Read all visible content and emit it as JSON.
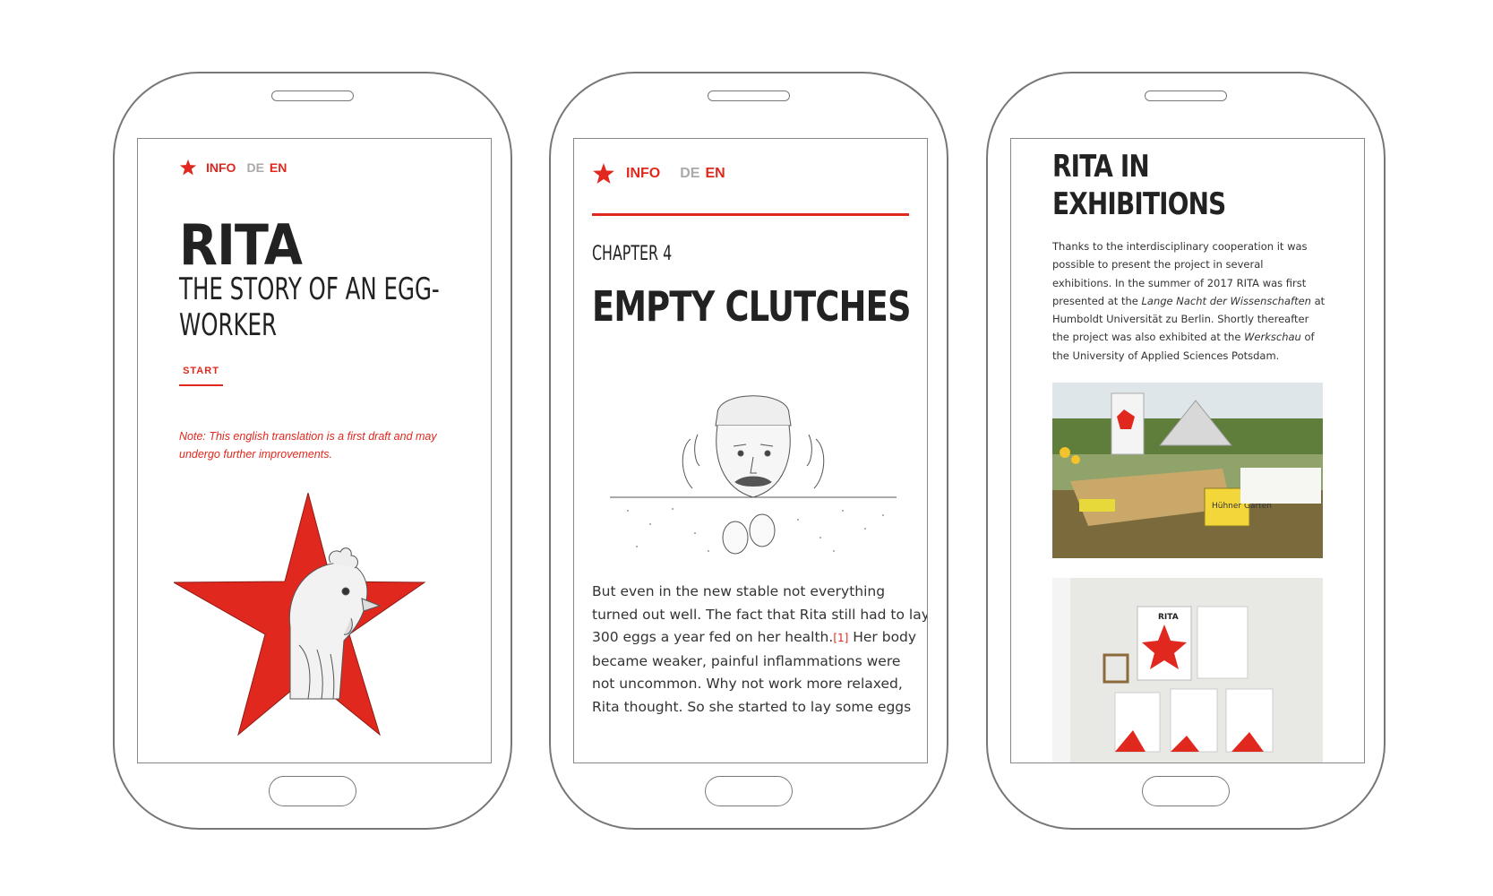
{
  "colors": {
    "accent": "#e0281e",
    "text": "#222222",
    "muted": "#aaaaaa",
    "frame": "#777777"
  },
  "nav": {
    "info": "INFO",
    "de": "DE",
    "en": "EN",
    "star_icon": "star-icon"
  },
  "screen1": {
    "title": "RITA",
    "subtitle_line1": "THE STORY OF AN EGG-",
    "subtitle_line2": "WORKER",
    "start": "START",
    "note_line1": "Note: This english translation is a first draft and may",
    "note_line2": "undergo further improvements."
  },
  "screen2": {
    "chapter": "CHAPTER 4",
    "title": "EMPTY CLUTCHES",
    "lines": [
      "But even in the new stable not everything",
      "turned out well. The fact that Rita still had to lay",
      "300 eggs a year fed on her health.",
      "became weaker, painful inflammations were",
      "not uncommon. Why not work more relaxed,",
      "Rita thought. So she started to lay some eggs"
    ],
    "footnote": "[1]",
    "line3_tail": " Her body"
  },
  "screen3": {
    "title_line1": "RITA IN",
    "title_line2": "EXHIBITIONS",
    "p1": "Thanks to the interdisciplinary cooperation it was",
    "p2": "possible to present the project in several",
    "p3": "exhibitions. In the summer of 2017 RITA was first",
    "p4a": "presented at the ",
    "p4b": "Lange Nacht der Wissenschaften",
    "p4c": " at",
    "p5": "Humboldt Universität zu Berlin. Shortly thereafter",
    "p6a": "the project was also exhibited at the ",
    "p6b": "Werkschau",
    "p6c": " of",
    "p7": "the University of Applied Sciences Potsdam.",
    "poster_title": "RITA",
    "sign_text": "Hühner Gärten"
  }
}
